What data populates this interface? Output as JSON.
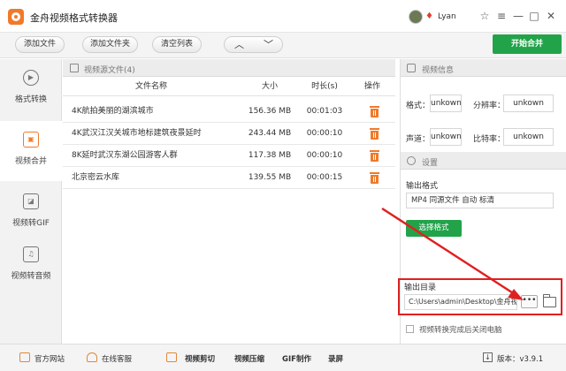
{
  "app": {
    "title": "金舟视频格式转换器"
  },
  "user": {
    "name": "Lyan"
  },
  "window_controls": {
    "skin": "☆",
    "menu": "≡",
    "minimize": "—",
    "maximize": "□",
    "close": "✕"
  },
  "toolbar": {
    "add_file": "添加文件",
    "add_folder": "添加文件夹",
    "clear_list": "清空列表",
    "move_up": "︿",
    "move_down": "﹀",
    "start_merge": "开始合并"
  },
  "sidebar": {
    "items": [
      {
        "label": "格式转换",
        "glyph": "▶"
      },
      {
        "label": "视频合并",
        "glyph": "▣"
      },
      {
        "label": "视频转GIF",
        "glyph": "◪"
      },
      {
        "label": "视频转音频",
        "glyph": "♫"
      }
    ]
  },
  "file_list": {
    "header": "视频源文件(4)",
    "columns": [
      "文件名称",
      "大小",
      "时长(s)",
      "操作"
    ],
    "rows": [
      {
        "name": "4K航拍美丽的湖滨城市",
        "size": "156.36 MB",
        "duration": "00:01:03"
      },
      {
        "name": "4K武汉江汉关城市地标建筑夜景延时",
        "size": "243.44 MB",
        "duration": "00:00:10"
      },
      {
        "name": "8K延时武汉东湖公园游客人群",
        "size": "117.38 MB",
        "duration": "00:00:10"
      },
      {
        "name": "北京密云水库",
        "size": "139.55 MB",
        "duration": "00:00:15"
      }
    ]
  },
  "video_info": {
    "header": "视频信息",
    "format_label": "格式：",
    "format_value": "unkown",
    "resolution_label": "分辨率：",
    "resolution_value": "unkown",
    "channel_label": "声道：",
    "channel_value": "unkown",
    "bitrate_label": "比特率：",
    "bitrate_value": "unkown"
  },
  "settings": {
    "header": "设置",
    "output_format_label": "输出格式",
    "output_format_value": "MP4 同源文件 自动 标清",
    "choose_format": "选择格式",
    "output_dir_label": "输出目录",
    "output_dir_value": "C:\\Users\\admin\\Desktop\\金舟视",
    "browse": "•••",
    "shutdown_label": "视频转换完成后关闭电脑"
  },
  "footer": {
    "website": "官方网站",
    "support": "在线客服",
    "video_cut": "视频剪切",
    "video_compress": "视频压缩",
    "gif_make": "GIF制作",
    "screen_record": "录屏",
    "version": "版本：v3.9.1",
    "download_glyph": "↓"
  },
  "colors": {
    "accent": "#f07a2a",
    "primary_green": "#22a34a",
    "highlight_red": "#e02020"
  }
}
